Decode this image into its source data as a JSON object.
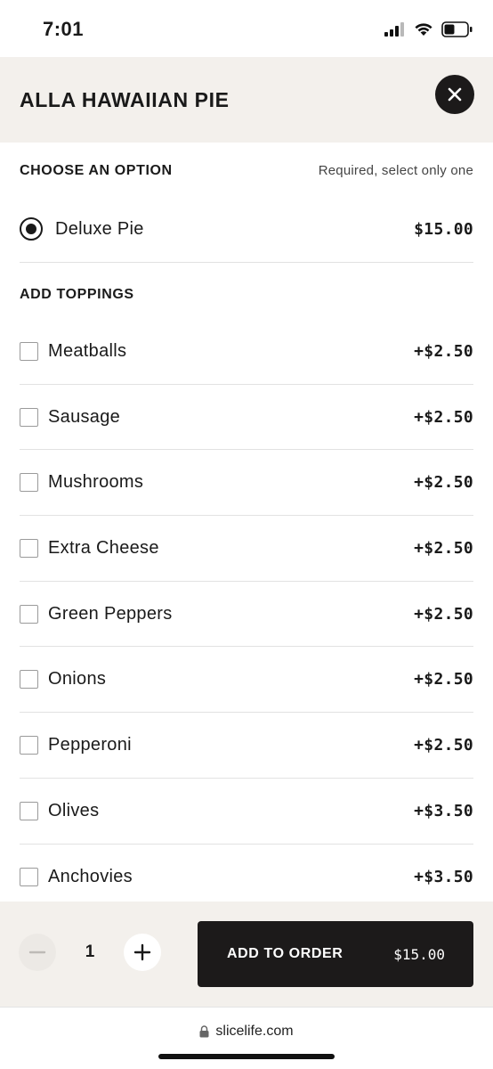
{
  "status_bar": {
    "time": "7:01",
    "icons": [
      "cellular-signal-icon",
      "wifi-icon",
      "battery-icon"
    ]
  },
  "header": {
    "title": "ALLA HAWAIIAN PIE",
    "close_icon": "close-icon"
  },
  "choose_option": {
    "heading": "CHOOSE AN OPTION",
    "note": "Required, select only one",
    "options": [
      {
        "label": "Deluxe Pie",
        "price": "$15.00",
        "selected": true
      }
    ]
  },
  "toppings": {
    "heading": "ADD TOPPINGS",
    "items": [
      {
        "label": "Meatballs",
        "price": "+$2.50",
        "checked": false
      },
      {
        "label": "Sausage",
        "price": "+$2.50",
        "checked": false
      },
      {
        "label": "Mushrooms",
        "price": "+$2.50",
        "checked": false
      },
      {
        "label": "Extra Cheese",
        "price": "+$2.50",
        "checked": false
      },
      {
        "label": "Green Peppers",
        "price": "+$2.50",
        "checked": false
      },
      {
        "label": "Onions",
        "price": "+$2.50",
        "checked": false
      },
      {
        "label": "Pepperoni",
        "price": "+$2.50",
        "checked": false
      },
      {
        "label": "Olives",
        "price": "+$3.50",
        "checked": false
      },
      {
        "label": "Anchovies",
        "price": "+$3.50",
        "checked": false
      }
    ]
  },
  "footer": {
    "quantity": "1",
    "add_label": "ADD TO ORDER",
    "add_price": "$15.00"
  },
  "browser": {
    "url": "slicelife.com"
  },
  "colors": {
    "header_bg": "#f3f0ec",
    "primary_dark": "#1c1a1a",
    "divider": "#e2e2e2"
  }
}
